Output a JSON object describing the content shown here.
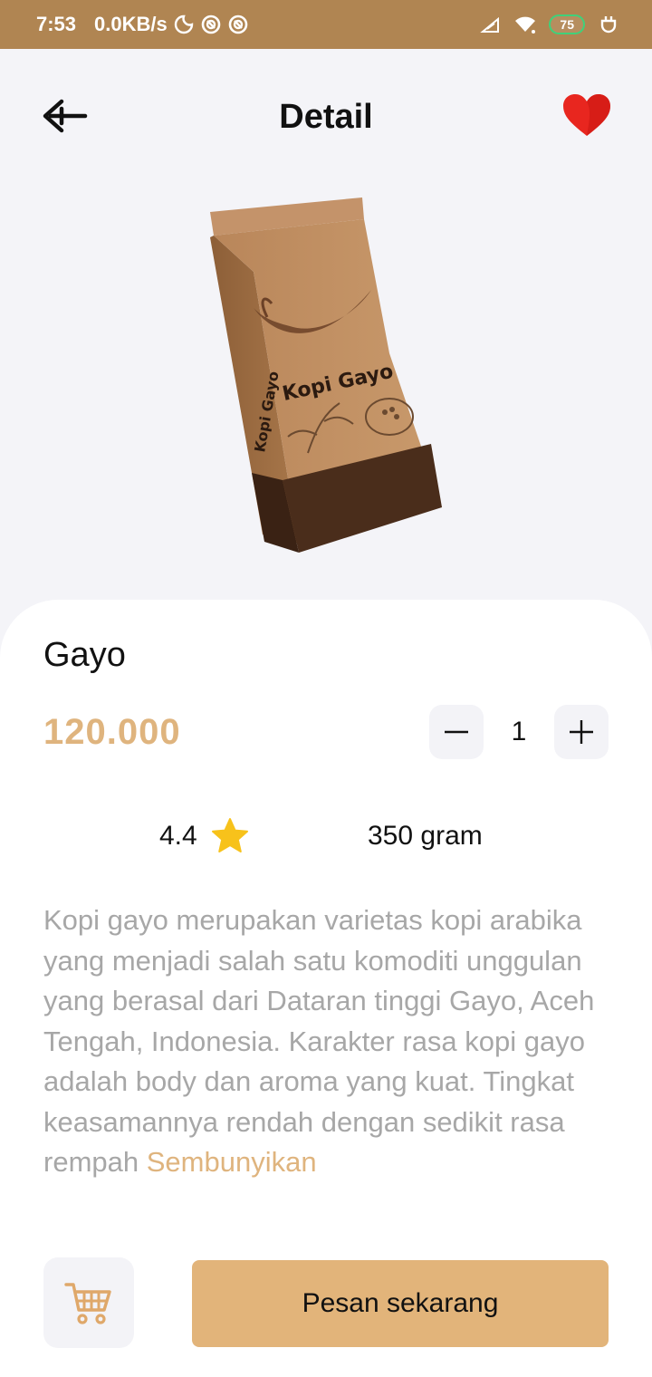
{
  "status_bar": {
    "time": "7:53",
    "net_speed": "0.0KB/s",
    "battery": "75"
  },
  "header": {
    "title": "Detail"
  },
  "product": {
    "name": "Gayo",
    "price": "120.000",
    "quantity": "1",
    "rating": "4.4",
    "weight": "350 gram",
    "description": "Kopi gayo merupakan varietas kopi arabika yang menjadi salah satu komoditi unggulan yang berasal dari Dataran tinggi Gayo, Aceh Tengah, Indonesia. Karakter rasa kopi gayo adalah body dan aroma yang kuat. Tingkat keasamannya rendah dengan sedikit rasa rempah",
    "description_toggle": "Sembunyikan",
    "package_label": "Kopi Gayo"
  },
  "actions": {
    "order_label": "Pesan sekarang"
  },
  "icons": {
    "back": "arrow-left-icon",
    "favorite": "heart-icon",
    "minus": "minus-icon",
    "plus": "plus-icon",
    "star": "star-icon",
    "cart": "cart-icon"
  },
  "colors": {
    "accent": "#dfb47e",
    "button": "#e2b47a",
    "status_bar": "#b08552",
    "heart": "#e8261f",
    "star": "#f7c21b"
  }
}
